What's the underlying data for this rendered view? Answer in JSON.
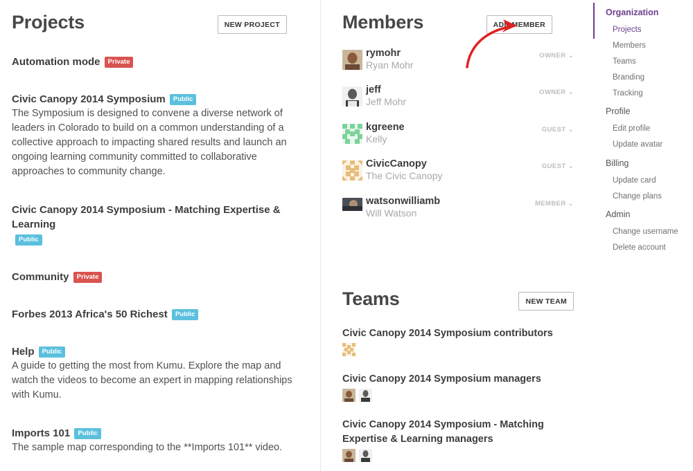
{
  "projects": {
    "title": "Projects",
    "new_button": "NEW PROJECT",
    "items": [
      {
        "title": "Automation mode",
        "badge": "Private",
        "description": ""
      },
      {
        "title": "Civic Canopy 2014 Symposium",
        "badge": "Public",
        "description": "The Symposium is designed to convene a diverse network of leaders in Colorado to build on a common understanding of a collective approach to impacting shared results and launch an ongoing learning community committed to collaborative approaches to community change."
      },
      {
        "title": "Civic Canopy 2014 Symposium - Matching Expertise & Learning",
        "badge": "Public",
        "description": ""
      },
      {
        "title": "Community",
        "badge": "Private",
        "description": ""
      },
      {
        "title": "Forbes 2013 Africa's 50 Richest",
        "badge": "Public",
        "description": ""
      },
      {
        "title": "Help",
        "badge": "Public",
        "description": "A guide to getting the most from Kumu. Explore the map and watch the videos to become an expert in mapping relationships with Kumu."
      },
      {
        "title": "Imports 101",
        "badge": "Public",
        "description": "The sample map corresponding to the **Imports 101** video."
      }
    ]
  },
  "members": {
    "title": "Members",
    "add_button": "ADD MEMBER",
    "items": [
      {
        "username": "rymohr",
        "name": "Ryan Mohr",
        "role": "OWNER",
        "avatar_icon": "photo-avatar"
      },
      {
        "username": "jeff",
        "name": "Jeff Mohr",
        "role": "OWNER",
        "avatar_icon": "photo-avatar"
      },
      {
        "username": "kgreene",
        "name": "Kelly",
        "role": "GUEST",
        "avatar_icon": "identicon-green"
      },
      {
        "username": "CivicCanopy",
        "name": "The Civic Canopy",
        "role": "GUEST",
        "avatar_icon": "identicon-tan"
      },
      {
        "username": "watsonwilliamb",
        "name": "Will Watson",
        "role": "MEMBER",
        "avatar_icon": "photo-avatar"
      }
    ]
  },
  "teams": {
    "title": "Teams",
    "new_button": "NEW TEAM",
    "items": [
      {
        "title": "Civic Canopy 2014 Symposium contributors"
      },
      {
        "title": "Civic Canopy 2014 Symposium managers"
      },
      {
        "title": "Civic Canopy 2014 Symposium - Matching Expertise & Learning managers"
      }
    ]
  },
  "nav": {
    "organization": "Organization",
    "org_items": [
      "Projects",
      "Members",
      "Teams",
      "Branding",
      "Tracking"
    ],
    "profile": "Profile",
    "profile_items": [
      "Edit profile",
      "Update avatar"
    ],
    "billing": "Billing",
    "billing_items": [
      "Update card",
      "Change plans"
    ],
    "admin": "Admin",
    "admin_items": [
      "Change username",
      "Delete account"
    ]
  },
  "colors": {
    "accent": "#6b3e8c",
    "private_badge": "#d9534f",
    "public_badge": "#5bc0de",
    "annotation_arrow": "#e02020"
  }
}
